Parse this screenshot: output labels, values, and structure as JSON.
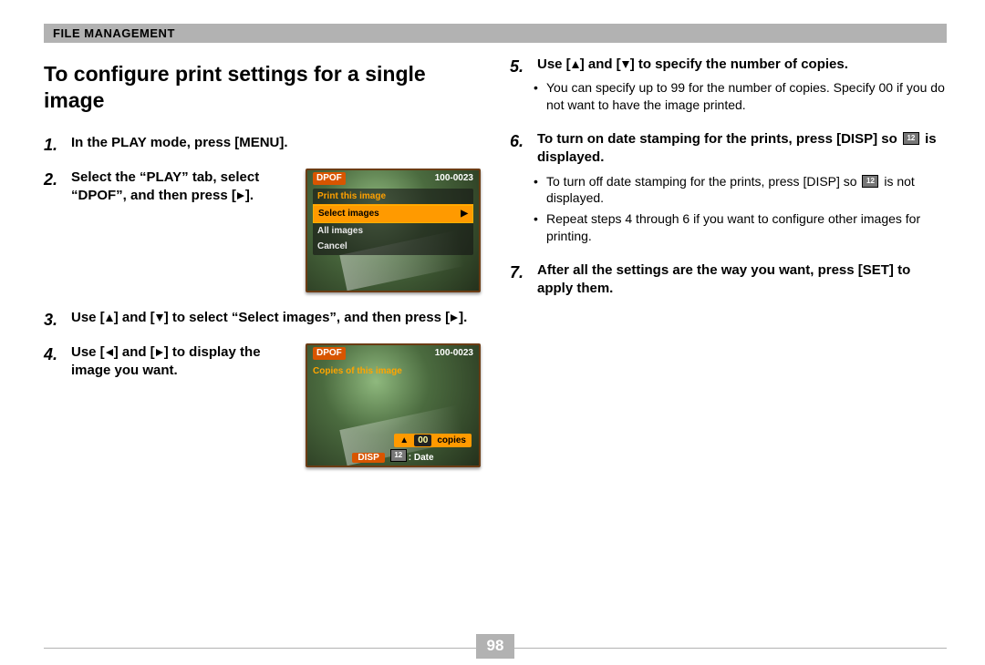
{
  "header": "File Management",
  "title": "To configure print settings for a single image",
  "page_number": "98",
  "left_steps": {
    "s1": "In the PLAY mode, press [MENU].",
    "s2_prefix": "Select the “PLAY” tab, select “DPOF”, and then press [",
    "s2_suffix": "].",
    "s3_prefix": "Use [",
    "s3_mid": "] and [",
    "s3_after": "] to select “Select images”, and then press [",
    "s3_suffix": "].",
    "s4_prefix": "Use [",
    "s4_mid": "] and [",
    "s4_after": "] to display the image you want."
  },
  "right_steps": {
    "s5_prefix": "Use [",
    "s5_mid": "] and [",
    "s5_after": "] to specify the number of copies.",
    "s5_sub1": "You can specify up to 99 for the number of copies. Specify 00 if you do not want to have the image printed.",
    "s6_line": "To turn on date stamping for the prints, press [DISP] so ",
    "s6_tail": " is displayed.",
    "s6_sub1a": "To turn off date stamping for the prints, press [DISP] so ",
    "s6_sub1b": " is not displayed.",
    "s6_sub2": "Repeat steps 4 through 6 if you want to configure other images for printing.",
    "s7": "After all the settings are the way you want, press [SET] to apply them."
  },
  "screen1": {
    "dpof": "DPOF",
    "file": "100-0023",
    "title": "Print this image",
    "row1": "Select images",
    "row2": "All images",
    "row3": "Cancel"
  },
  "screen2": {
    "dpof": "DPOF",
    "file": "100-0023",
    "title": "Copies of this image",
    "count": "00",
    "copies_label": "copies",
    "disp": "DISP",
    "date": ": Date"
  }
}
